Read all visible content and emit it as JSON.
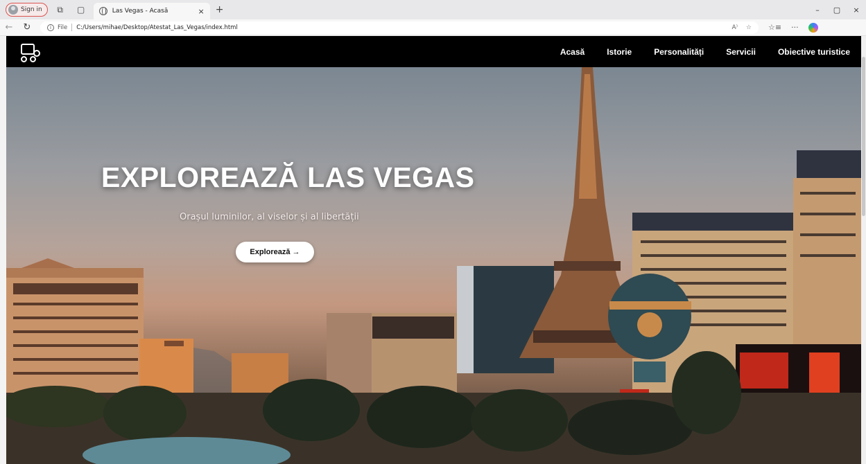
{
  "browser": {
    "signin_label": "Sign in",
    "tab_title": "Las Vegas - Acasă",
    "tab_close": "×",
    "new_tab": "+",
    "url_scheme_label": "File",
    "url": "C:/Users/mihae/Desktop/Atestat_Las_Vegas/index.html",
    "window_controls": {
      "minimize": "–",
      "maximize": "▢",
      "close": "×"
    },
    "icons": [
      "back-icon",
      "refresh-icon",
      "read-aloud-icon",
      "favorite-icon",
      "collections-icon",
      "more-icon",
      "copilot-icon"
    ]
  },
  "navbar": {
    "items": [
      {
        "label": "Acasă",
        "active": true
      },
      {
        "label": "Istorie"
      },
      {
        "label": "Personalități"
      },
      {
        "label": "Servicii"
      },
      {
        "label": "Obiective turistice"
      }
    ]
  },
  "hero": {
    "title": "EXPLOREAZĂ LAS VEGAS",
    "subtitle": "Orașul luminilor, al viselor și al libertății",
    "button_label": "Explorează →"
  },
  "colors": {
    "navbar_bg": "#000000",
    "text_light": "#ffffff",
    "button_bg": "#ffffff",
    "signin_border": "#d9534f"
  }
}
